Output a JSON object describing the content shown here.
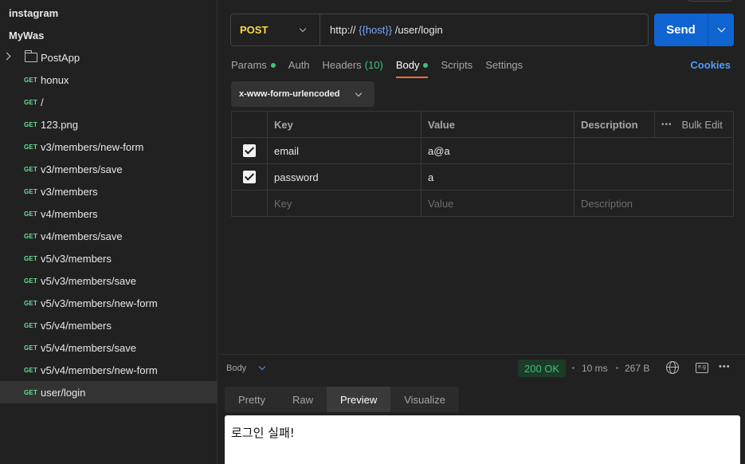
{
  "sidebar": {
    "collections": [
      "instagram",
      "MyWas"
    ],
    "folder": {
      "name": "PostApp"
    },
    "requests": [
      {
        "method": "GET",
        "name": "honux"
      },
      {
        "method": "GET",
        "name": "/"
      },
      {
        "method": "GET",
        "name": "123.png"
      },
      {
        "method": "GET",
        "name": "v3/members/new-form"
      },
      {
        "method": "GET",
        "name": "v3/members/save"
      },
      {
        "method": "GET",
        "name": "v3/members"
      },
      {
        "method": "GET",
        "name": "v4/members"
      },
      {
        "method": "GET",
        "name": "v4/members/save"
      },
      {
        "method": "GET",
        "name": "v5/v3/members"
      },
      {
        "method": "GET",
        "name": "v5/v3/members/save"
      },
      {
        "method": "GET",
        "name": "v5/v3/members/new-form"
      },
      {
        "method": "GET",
        "name": "v5/v4/members"
      },
      {
        "method": "GET",
        "name": "v5/v4/members/save"
      },
      {
        "method": "GET",
        "name": "v5/v4/members/new-form"
      },
      {
        "method": "GET",
        "name": "user/login"
      }
    ]
  },
  "request": {
    "method": "POST",
    "url_prefix": "http:// ",
    "url_var": "{{host}}",
    "url_suffix": " /user/login",
    "send_label": "Send"
  },
  "tabs": {
    "params": "Params",
    "auth": "Auth",
    "headers": "Headers",
    "headers_count": "(10)",
    "body": "Body",
    "scripts": "Scripts",
    "settings": "Settings",
    "cookies": "Cookies"
  },
  "body_type": "x-www-form-urlencoded",
  "table": {
    "headers": {
      "key": "Key",
      "value": "Value",
      "description": "Description",
      "bulk_edit": "Bulk Edit"
    },
    "rows": [
      {
        "key": "email",
        "value": "a@a",
        "description": ""
      },
      {
        "key": "password",
        "value": "a",
        "description": ""
      }
    ],
    "placeholders": {
      "key": "Key",
      "value": "Value",
      "description": "Description"
    }
  },
  "response": {
    "label": "Body",
    "status": "200 OK",
    "time": "10 ms",
    "size": "267 B",
    "save_icon_text": "e.g",
    "view_tabs": [
      "Pretty",
      "Raw",
      "Preview",
      "Visualize"
    ],
    "active_view": "Preview",
    "preview_text": "로그인 실패!"
  },
  "colors": {
    "accent": "#ff6c37",
    "send": "#0f64d2",
    "method_post": "#fbd74a",
    "method_get": "#6bdd9a",
    "status_ok": "#3ec27a",
    "link": "#4d9bff"
  }
}
